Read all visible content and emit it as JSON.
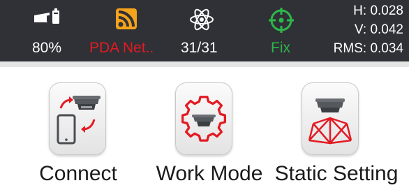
{
  "status": {
    "battery": {
      "icon": "receiver-battery-icon",
      "value": "80%"
    },
    "network": {
      "icon": "pda-network-signal-icon",
      "value": "PDA Net..",
      "color": "#e31b23"
    },
    "satellites": {
      "icon": "satellite-atom-icon",
      "value": "31/31"
    },
    "solution": {
      "icon": "crosshair-fix-icon",
      "value": "Fix",
      "color": "#2db84a"
    },
    "precision": {
      "h": "H: 0.028",
      "v": "V: 0.042",
      "rms": "RMS: 0.034"
    },
    "icon_orange": "#f5a31a"
  },
  "tiles": [
    {
      "icon": "connect-device-icon",
      "label": "Connect"
    },
    {
      "icon": "work-mode-gear-icon",
      "label": "Work Mode"
    },
    {
      "icon": "static-setting-tripod-icon",
      "label": "Static Setting"
    }
  ],
  "accent_red": "#e31b23"
}
